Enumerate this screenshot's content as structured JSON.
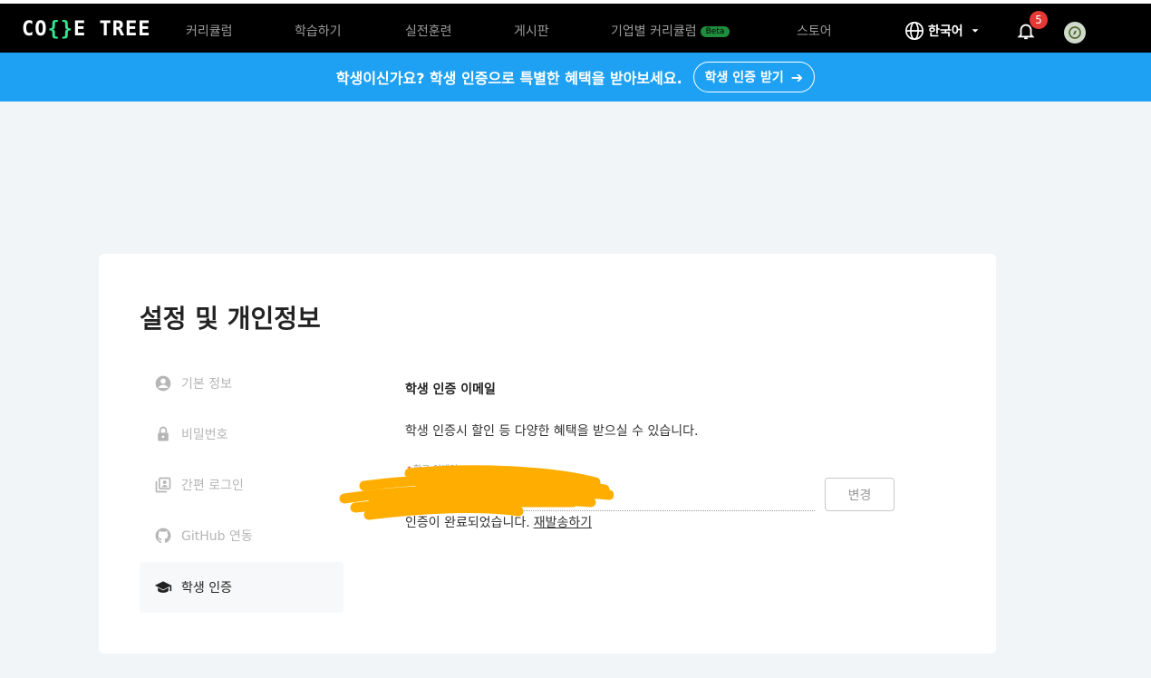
{
  "header": {
    "logo_left": "CO",
    "logo_mid": "{}",
    "logo_right": "E TREE",
    "nav": [
      {
        "label": "커리큘럼"
      },
      {
        "label": "학습하기"
      },
      {
        "label": "실전훈련"
      },
      {
        "label": "게시판"
      },
      {
        "label": "기업별 커리큘럼",
        "badge": "Beta"
      },
      {
        "label": "스토어"
      }
    ],
    "language": "한국어",
    "notification_count": "5"
  },
  "banner": {
    "text": "학생이신가요? 학생 인증으로 특별한 혜택을 받아보세요.",
    "button_label": "학생 인증 받기"
  },
  "page": {
    "title": "설정 및 개인정보"
  },
  "sidebar": {
    "items": [
      {
        "label": "기본 정보",
        "icon": "user-circle-icon"
      },
      {
        "label": "비밀번호",
        "icon": "lock-icon"
      },
      {
        "label": "간편 로그인",
        "icon": "account-box-icon"
      },
      {
        "label": "GitHub 연동",
        "icon": "github-icon"
      },
      {
        "label": "학생 인증",
        "icon": "graduation-cap-icon"
      }
    ],
    "active_index": 4
  },
  "section": {
    "title": "학생 인증 이메일",
    "description": "학생 인증시 할인 등 다양한 혜택을 받으실 수 있습니다.",
    "field_required_mark": "*",
    "field_label": "학교 이메일",
    "email_value": "",
    "change_button": "변경",
    "status_text": "인증이 완료되었습니다.",
    "resend_link": "재발송하기"
  },
  "colors": {
    "banner": "#1ea1f2",
    "logo_accent": "#36e58f",
    "badge_red": "#e53935",
    "redaction": "#ffae00"
  }
}
